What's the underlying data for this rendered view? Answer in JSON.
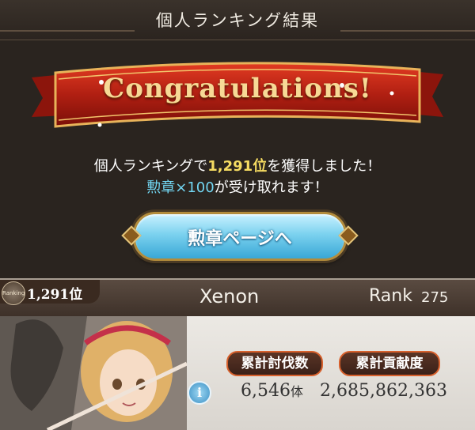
{
  "header": {
    "title": "個人ランキング結果"
  },
  "banner": {
    "text": "Congratulations!"
  },
  "message": {
    "line1_prefix": "個人ランキングで",
    "line1_rank": "1,291位",
    "line1_suffix": "を獲得しました！",
    "line2_item": "勲章×100",
    "line2_suffix": "が受け取れます！"
  },
  "button": {
    "label": "勲章ページへ"
  },
  "card": {
    "badge_text": "Ranking",
    "rank": "1,291位",
    "player_name": "Xenon",
    "rank_label": "Rank",
    "rank_value": "275",
    "kills_label": "累計討伐数",
    "contrib_label": "累計貢献度",
    "info_symbol": "i",
    "kills_value": "6,546",
    "kills_unit": "体",
    "contrib_value": "2,685,862,363"
  },
  "colors": {
    "accent_yellow": "#f6dc62",
    "accent_cyan": "#72d6f2",
    "banner_red": "#b01f12",
    "pill_border": "#d7602c"
  }
}
